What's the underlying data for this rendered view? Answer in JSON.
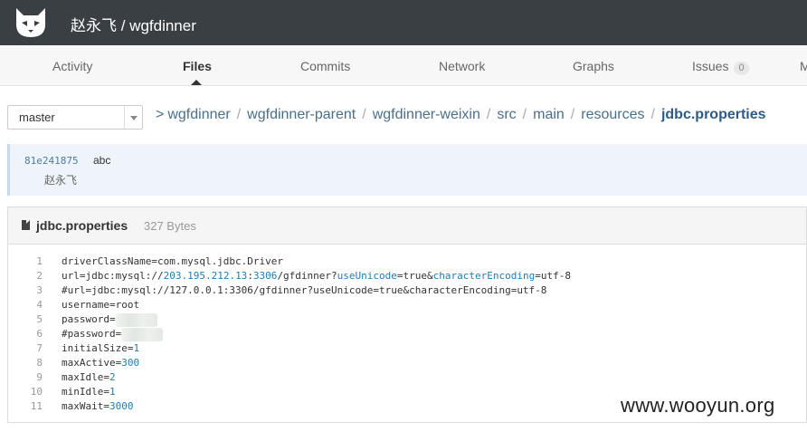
{
  "header": {
    "owner": "赵永飞",
    "repo": "wgfdinner",
    "title": "赵永飞 / wgfdinner",
    "logo_icon": "gogs-cat-logo-icon"
  },
  "tabs": [
    {
      "label": "Activity"
    },
    {
      "label": "Files",
      "active": true
    },
    {
      "label": "Commits"
    },
    {
      "label": "Network"
    },
    {
      "label": "Graphs"
    },
    {
      "label": "Issues",
      "badge": "0"
    },
    {
      "label": "M"
    }
  ],
  "branch": {
    "selected": "master"
  },
  "breadcrumb": {
    "chevron": ">",
    "items": [
      "wgfdinner",
      "wgfdinner-parent",
      "wgfdinner-weixin",
      "src",
      "main",
      "resources"
    ],
    "current": "jdbc.properties",
    "separator": "/"
  },
  "commit": {
    "sha": "81e241875",
    "message": "abc",
    "author": "赵永飞"
  },
  "file": {
    "name": "jdbc.properties",
    "size": "327 Bytes",
    "line_numbers": [
      "1",
      "2",
      "3",
      "4",
      "5",
      "6",
      "7",
      "8",
      "9",
      "10",
      "11"
    ],
    "lines": [
      {
        "parts": [
          {
            "t": "driverClassName=com.mysql.jdbc.Driver"
          }
        ]
      },
      {
        "parts": [
          {
            "t": "url=jdbc:mysql://"
          },
          {
            "t": "203.195.212.13",
            "c": "num"
          },
          {
            "t": ":"
          },
          {
            "t": "3306",
            "c": "num"
          },
          {
            "t": "/gfdinner?"
          },
          {
            "t": "useUnicode",
            "c": "str"
          },
          {
            "t": "=true&"
          },
          {
            "t": "characterEncoding",
            "c": "str"
          },
          {
            "t": "=utf-8"
          }
        ]
      },
      {
        "parts": [
          {
            "t": "#url=jdbc:mysql://127.0.0.1:3306/gfdinner?useUnicode=true&characterEncoding=utf-8"
          }
        ]
      },
      {
        "parts": [
          {
            "t": "username=root"
          }
        ]
      },
      {
        "parts": [
          {
            "t": "password="
          },
          {
            "t": "",
            "c": "blur"
          }
        ]
      },
      {
        "parts": [
          {
            "t": "#password="
          },
          {
            "t": "",
            "c": "blur"
          }
        ]
      },
      {
        "parts": [
          {
            "t": "initialSize="
          },
          {
            "t": "1",
            "c": "num"
          }
        ]
      },
      {
        "parts": [
          {
            "t": "maxActive="
          },
          {
            "t": "300",
            "c": "num"
          }
        ]
      },
      {
        "parts": [
          {
            "t": "maxIdle="
          },
          {
            "t": "2",
            "c": "num"
          }
        ]
      },
      {
        "parts": [
          {
            "t": "minIdle="
          },
          {
            "t": "1",
            "c": "num"
          }
        ]
      },
      {
        "parts": [
          {
            "t": "maxWait="
          },
          {
            "t": "3000",
            "c": "num"
          }
        ]
      }
    ]
  },
  "watermark": "www.wooyun.org"
}
